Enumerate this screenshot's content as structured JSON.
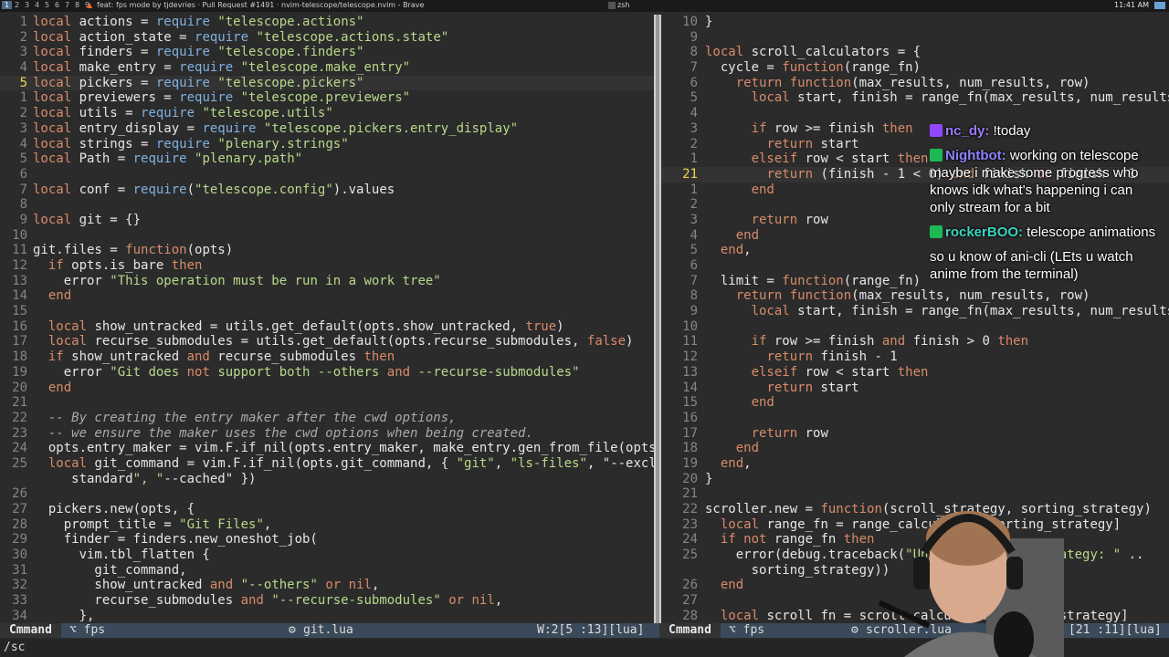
{
  "topbar": {
    "workspaces": [
      "1",
      "2",
      "3",
      "4",
      "5",
      "6",
      "7",
      "8",
      "9"
    ],
    "active_workspace": "1",
    "window_title_left": "feat: fps mode by tjdevries · Pull Request #1491 · nvim-telescope/telescope.nvim - Brave",
    "window_title_right": "zsh",
    "clock": "11:41 AM"
  },
  "left_pane": {
    "lines": [
      {
        "n": "1",
        "t": "local actions = require \"telescope.actions\""
      },
      {
        "n": "2",
        "t": "local action_state = require \"telescope.actions.state\""
      },
      {
        "n": "3",
        "t": "local finders = require \"telescope.finders\""
      },
      {
        "n": "4",
        "t": "local make_entry = require \"telescope.make_entry\""
      },
      {
        "n": "5",
        "t": "local pickers = require \"telescope.pickers\"",
        "cur": true
      },
      {
        "n": "1",
        "t": "local previewers = require \"telescope.previewers\""
      },
      {
        "n": "2",
        "t": "local utils = require \"telescope.utils\""
      },
      {
        "n": "3",
        "t": "local entry_display = require \"telescope.pickers.entry_display\""
      },
      {
        "n": "4",
        "t": "local strings = require \"plenary.strings\""
      },
      {
        "n": "5",
        "t": "local Path = require \"plenary.path\""
      },
      {
        "n": "6",
        "t": ""
      },
      {
        "n": "7",
        "t": "local conf = require(\"telescope.config\").values"
      },
      {
        "n": "8",
        "t": ""
      },
      {
        "n": "9",
        "t": "local git = {}"
      },
      {
        "n": "10",
        "t": ""
      },
      {
        "n": "11",
        "t": "git.files = function(opts)"
      },
      {
        "n": "12",
        "t": "  if opts.is_bare then"
      },
      {
        "n": "13",
        "t": "    error \"This operation must be run in a work tree\""
      },
      {
        "n": "14",
        "t": "  end"
      },
      {
        "n": "15",
        "t": ""
      },
      {
        "n": "16",
        "t": "  local show_untracked = utils.get_default(opts.show_untracked, true)"
      },
      {
        "n": "17",
        "t": "  local recurse_submodules = utils.get_default(opts.recurse_submodules, false)"
      },
      {
        "n": "18",
        "t": "  if show_untracked and recurse_submodules then"
      },
      {
        "n": "19",
        "t": "    error \"Git does not support both --others and --recurse-submodules\""
      },
      {
        "n": "20",
        "t": "  end"
      },
      {
        "n": "21",
        "t": ""
      },
      {
        "n": "22",
        "t": "  -- By creating the entry maker after the cwd options,"
      },
      {
        "n": "23",
        "t": "  -- we ensure the maker uses the cwd options when being created."
      },
      {
        "n": "24",
        "t": "  opts.entry_maker = vim.F.if_nil(opts.entry_maker, make_entry.gen_from_file(opts))"
      },
      {
        "n": "25",
        "t": "  local git_command = vim.F.if_nil(opts.git_command, { \"git\", \"ls-files\", \"--exclude-"
      },
      {
        "n": "",
        "t": "     standard\", \"--cached\" })"
      },
      {
        "n": "26",
        "t": ""
      },
      {
        "n": "27",
        "t": "  pickers.new(opts, {"
      },
      {
        "n": "28",
        "t": "    prompt_title = \"Git Files\","
      },
      {
        "n": "29",
        "t": "    finder = finders.new_oneshot_job("
      },
      {
        "n": "30",
        "t": "      vim.tbl_flatten {"
      },
      {
        "n": "31",
        "t": "        git_command,"
      },
      {
        "n": "32",
        "t": "        show_untracked and \"--others\" or nil,"
      },
      {
        "n": "33",
        "t": "        recurse_submodules and \"--recurse-submodules\" or nil,"
      },
      {
        "n": "34",
        "t": "      },"
      }
    ]
  },
  "right_pane": {
    "lines": [
      {
        "n": "10",
        "t": "}"
      },
      {
        "n": "9",
        "t": ""
      },
      {
        "n": "8",
        "t": "local scroll_calculators = {"
      },
      {
        "n": "7",
        "t": "  cycle = function(range_fn)"
      },
      {
        "n": "6",
        "t": "    return function(max_results, num_results, row)"
      },
      {
        "n": "5",
        "t": "      local start, finish = range_fn(max_results, num_results)"
      },
      {
        "n": "4",
        "t": ""
      },
      {
        "n": "3",
        "t": "      if row >= finish then"
      },
      {
        "n": "2",
        "t": "        return start"
      },
      {
        "n": "1",
        "t": "      elseif row < start then"
      },
      {
        "n": "21",
        "t": "        return (finish - 1 < 0) and finish or finish - 1",
        "cur": true
      },
      {
        "n": "1",
        "t": "      end"
      },
      {
        "n": "2",
        "t": ""
      },
      {
        "n": "3",
        "t": "      return row"
      },
      {
        "n": "4",
        "t": "    end"
      },
      {
        "n": "5",
        "t": "  end,"
      },
      {
        "n": "6",
        "t": ""
      },
      {
        "n": "7",
        "t": "  limit = function(range_fn)"
      },
      {
        "n": "8",
        "t": "    return function(max_results, num_results, row)"
      },
      {
        "n": "9",
        "t": "      local start, finish = range_fn(max_results, num_results)"
      },
      {
        "n": "10",
        "t": ""
      },
      {
        "n": "11",
        "t": "      if row >= finish and finish > 0 then"
      },
      {
        "n": "12",
        "t": "        return finish - 1"
      },
      {
        "n": "13",
        "t": "      elseif row < start then"
      },
      {
        "n": "14",
        "t": "        return start"
      },
      {
        "n": "15",
        "t": "      end"
      },
      {
        "n": "16",
        "t": ""
      },
      {
        "n": "17",
        "t": "      return row"
      },
      {
        "n": "18",
        "t": "    end"
      },
      {
        "n": "19",
        "t": "  end,"
      },
      {
        "n": "20",
        "t": "}"
      },
      {
        "n": "21",
        "t": ""
      },
      {
        "n": "22",
        "t": "scroller.new = function(scroll_strategy, sorting_strategy)"
      },
      {
        "n": "23",
        "t": "  local range_fn = range_calculators[sorting_strategy]"
      },
      {
        "n": "24",
        "t": "  if not range_fn then"
      },
      {
        "n": "25",
        "t": "    error(debug.traceback(\"Unknown sorting strategy: \" .."
      },
      {
        "n": "",
        "t": "      sorting_strategy))"
      },
      {
        "n": "26",
        "t": "  end"
      },
      {
        "n": "27",
        "t": ""
      },
      {
        "n": "28",
        "t": "  local scroll_fn = scroll_calculators[scroll_strategy]"
      }
    ]
  },
  "statusline": {
    "left_mode": "Cmmand",
    "left_branch": "⌥ fps",
    "left_file": "git.lua",
    "left_pos": "W:2[5   :13][lua]",
    "right_mode": "Cmmand",
    "right_branch": "⌥ fps",
    "right_file": "scroller.lua",
    "right_pos": "[21 :11][lua]"
  },
  "cmdline": "/sc",
  "chat": [
    {
      "user": "nc_dy",
      "color": "#9b7bff",
      "badge": "purple",
      "text": "!today"
    },
    {
      "user": "Nightbot",
      "color": "#8f82ff",
      "badge": "green",
      "text": "working on telescope maybe i make some progress who knows idk what's happening i can only stream for a bit"
    },
    {
      "user": "rockerBOO",
      "color": "#3ad6c1",
      "badge": "green",
      "text": "telescope animations"
    },
    {
      "user": "",
      "color": "#ffd200",
      "badge": "",
      "text": "so u know of ani-cli (LEts u watch anime from the terminal)"
    }
  ]
}
